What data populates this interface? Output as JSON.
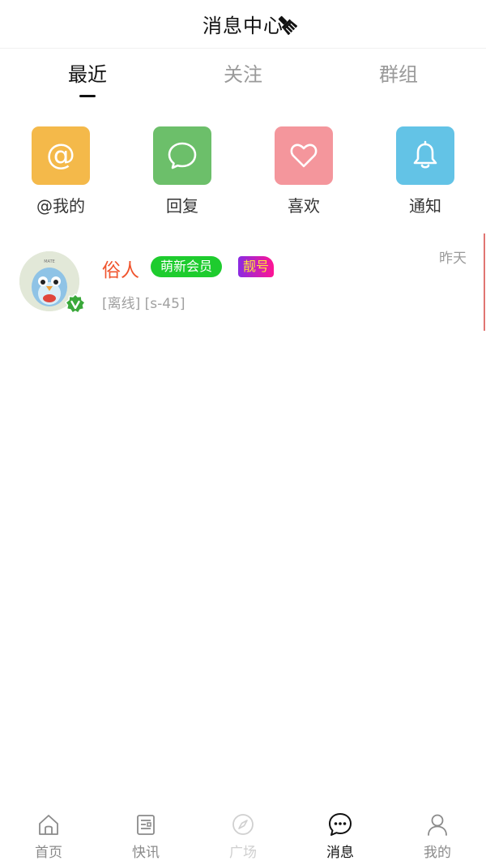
{
  "header": {
    "title": "消息中心"
  },
  "tabs": [
    {
      "label": "最近",
      "active": true
    },
    {
      "label": "关注",
      "active": false
    },
    {
      "label": "群组",
      "active": false
    }
  ],
  "actions": [
    {
      "label": "@我的",
      "icon": "at-icon",
      "color": "#f4b94a"
    },
    {
      "label": "回复",
      "icon": "chat-bubble-icon",
      "color": "#6cbf6a"
    },
    {
      "label": "喜欢",
      "icon": "heart-icon",
      "color": "#f4969c"
    },
    {
      "label": "通知",
      "icon": "bell-icon",
      "color": "#63c3e6"
    }
  ],
  "messages": [
    {
      "name": "俗人",
      "badge_member": "萌新会员",
      "badge_pretty": "靓号",
      "time": "昨天",
      "preview": "[离线] [s-45]"
    }
  ],
  "bottom_nav": [
    {
      "label": "首页",
      "icon": "home-icon",
      "state": "normal"
    },
    {
      "label": "快讯",
      "icon": "news-icon",
      "state": "normal"
    },
    {
      "label": "广场",
      "icon": "compass-icon",
      "state": "disabled"
    },
    {
      "label": "消息",
      "icon": "message-icon",
      "state": "active"
    },
    {
      "label": "我的",
      "icon": "user-icon",
      "state": "normal"
    }
  ],
  "colors": {
    "name": "#f0542d",
    "member_badge": "#1ecc2e",
    "pretty_badge_text": "#ffe23a"
  }
}
